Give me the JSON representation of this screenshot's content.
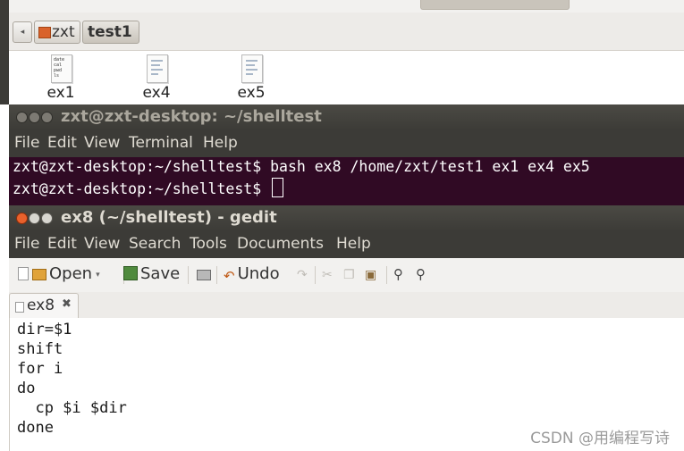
{
  "file_manager": {
    "breadcrumb": {
      "back_glyph": "◂",
      "items": [
        "zxt",
        "test1"
      ]
    },
    "files": [
      {
        "name": "ex1",
        "preview": [
          "date",
          "cal",
          "pwd",
          "ls"
        ]
      },
      {
        "name": "ex4",
        "preview": []
      },
      {
        "name": "ex5",
        "preview": []
      }
    ]
  },
  "terminal": {
    "title": "zxt@zxt-desktop: ~/shelltest",
    "menu": [
      "File",
      "Edit",
      "View",
      "Terminal",
      "Help"
    ],
    "lines": [
      "zxt@zxt-desktop:~/shelltest$ bash ex8 /home/zxt/test1 ex1 ex4 ex5",
      "zxt@zxt-desktop:~/shelltest$ "
    ]
  },
  "gedit": {
    "title": "ex8 (~/shelltest) - gedit",
    "menu": [
      "File",
      "Edit",
      "View",
      "Search",
      "Tools",
      "Documents",
      "Help"
    ],
    "toolbar": {
      "open_label": "Open",
      "open_caret": "▾",
      "save_label": "Save",
      "undo_label": "Undo"
    },
    "tab": {
      "label": "ex8",
      "close_glyph": "✖"
    },
    "code": [
      "dir=$1",
      "shift",
      "for i",
      "do",
      "  cp $i $dir",
      "done"
    ]
  },
  "watermark": "CSDN @用编程写诗",
  "colors": {
    "terminal_bg": "#300a24",
    "titlebar_bg": "#3c3b37",
    "close_button": "#e9612c"
  }
}
